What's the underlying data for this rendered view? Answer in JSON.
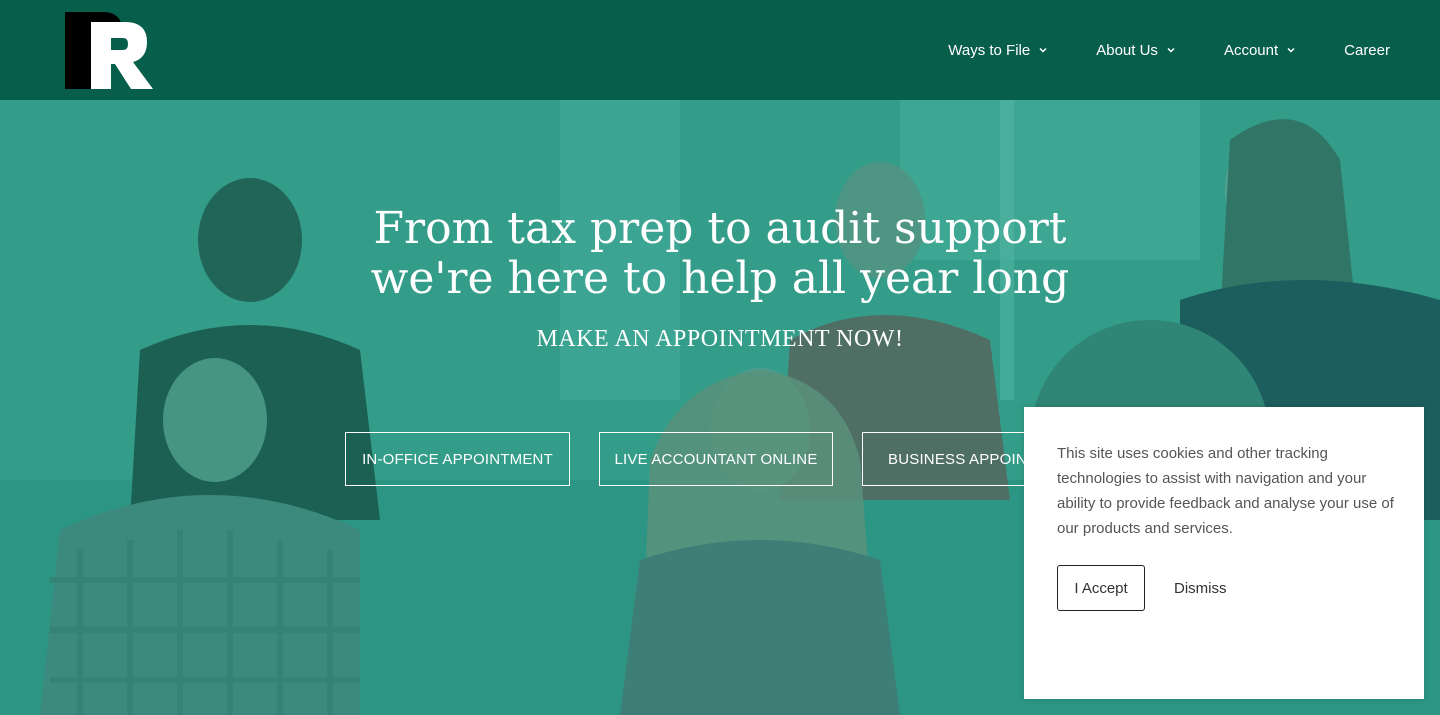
{
  "brand": {
    "logo_letters": "PR",
    "colors": {
      "header": "#075e4b",
      "hero_tint": "#3f9b88"
    }
  },
  "nav": {
    "items": [
      {
        "label": "Ways to File",
        "has_dropdown": true,
        "icon": "chevron-down-icon"
      },
      {
        "label": "About Us",
        "has_dropdown": true,
        "icon": "chevron-down-icon"
      },
      {
        "label": "Account",
        "has_dropdown": true,
        "icon": "chevron-down-icon"
      },
      {
        "label": "Career",
        "has_dropdown": false
      }
    ]
  },
  "hero": {
    "headline_line1": "From tax prep to audit support",
    "headline_line2": "we're here to help all year long",
    "subline": "MAKE AN APPOINTMENT NOW!",
    "buttons": [
      {
        "label": "IN-OFFICE APPOINTMENT"
      },
      {
        "label": "LIVE ACCOUNTANT ONLINE"
      },
      {
        "label": "BUSINESS APPOINTMENT"
      }
    ]
  },
  "cookie": {
    "text": "This site uses cookies and other tracking technologies to assist with navigation and your ability to provide feedback and analyse your use of our products and services.",
    "accept_label": "I Accept",
    "dismiss_label": "Dismiss"
  }
}
